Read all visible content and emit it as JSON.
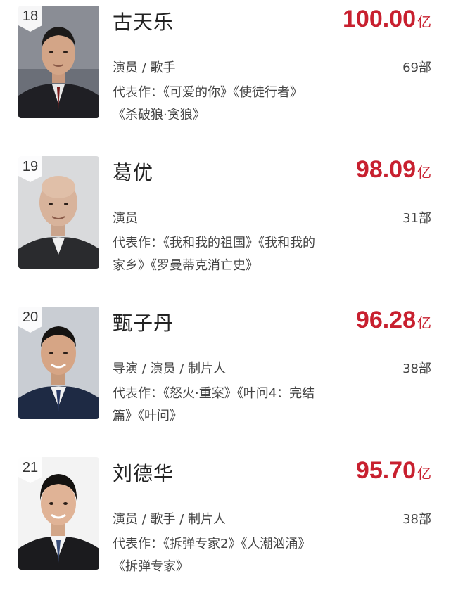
{
  "rankings": [
    {
      "rank": "18",
      "name": "古天乐",
      "box_office_value": "100.00",
      "box_office_unit": "亿",
      "roles": "演员 / 歌手",
      "works_count": "69部",
      "works_line1": "代表作：《可爱的你》《使徒行者》",
      "works_line2": "《杀破狼·贪狼》"
    },
    {
      "rank": "19",
      "name": "葛优",
      "box_office_value": "98.09",
      "box_office_unit": "亿",
      "roles": "演员",
      "works_count": "31部",
      "works_line1": "代表作：《我和我的祖国》《我和我的",
      "works_line2": "家乡》《罗曼蒂克消亡史》"
    },
    {
      "rank": "20",
      "name": "甄子丹",
      "box_office_value": "96.28",
      "box_office_unit": "亿",
      "roles": "导演 / 演员 / 制片人",
      "works_count": "38部",
      "works_line1": "代表作：《怒火·重案》《叶问4：完结",
      "works_line2": "篇》《叶问》"
    },
    {
      "rank": "21",
      "name": "刘德华",
      "box_office_value": "95.70",
      "box_office_unit": "亿",
      "roles": "演员 / 歌手 / 制片人",
      "works_count": "38部",
      "works_line1": "代表作：《拆弹专家2》《人潮汹涌》",
      "works_line2": "《拆弹专家》"
    }
  ],
  "colors": {
    "accent_red": "#c8202f",
    "badge_bg": "#ffffff",
    "text": "#444444"
  },
  "icons": {
    "rank_badge": "shield-badge-icon",
    "photo": "portrait-photo"
  }
}
